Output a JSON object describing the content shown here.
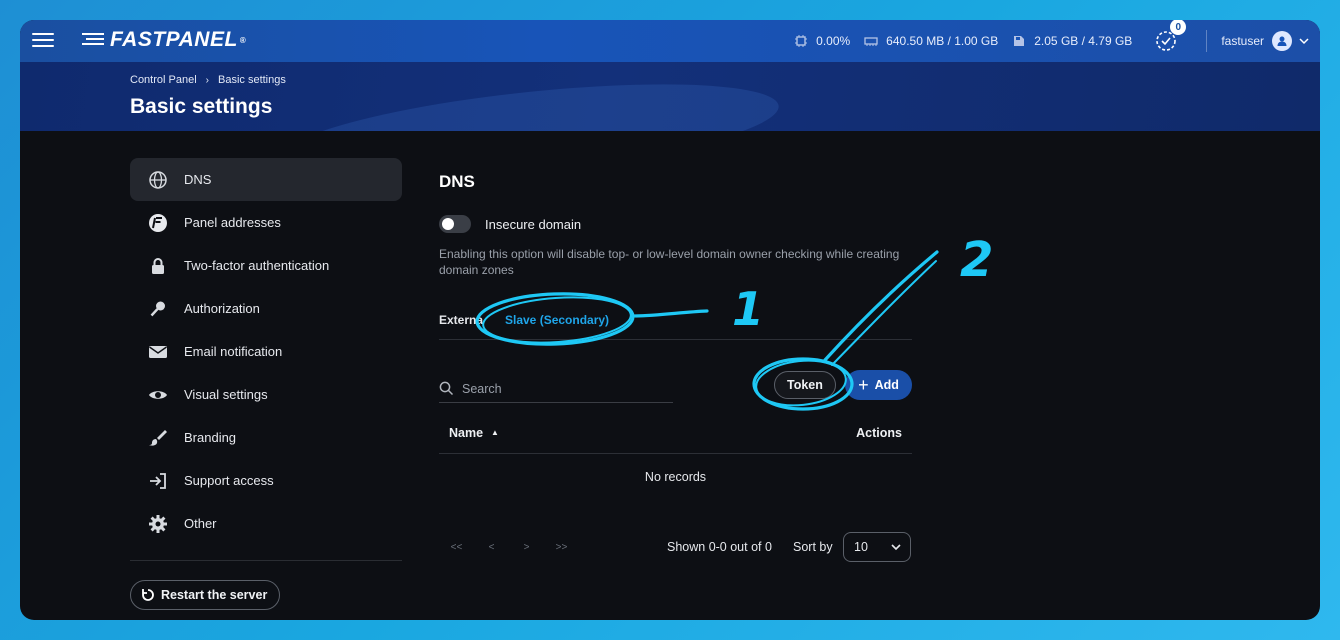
{
  "app": {
    "logo_text": "FASTPANEL",
    "trademark": "®"
  },
  "topbar": {
    "cpu": "0.00%",
    "ram": "640.50 MB / 1.00 GB",
    "disk": "2.05 GB / 4.79 GB",
    "tasks_count": "0",
    "username": "fastuser"
  },
  "breadcrumb": {
    "items": [
      "Control Panel",
      "Basic settings"
    ]
  },
  "page_title": "Basic settings",
  "sidebar": {
    "items": [
      {
        "label": "DNS",
        "icon": "globe-icon"
      },
      {
        "label": "Panel addresses",
        "icon": "fastpanel-f-icon"
      },
      {
        "label": "Two-factor authentication",
        "icon": "lock-icon"
      },
      {
        "label": "Authorization",
        "icon": "key-icon"
      },
      {
        "label": "Email notification",
        "icon": "envelope-icon"
      },
      {
        "label": "Visual settings",
        "icon": "eye-icon"
      },
      {
        "label": "Branding",
        "icon": "brush-icon"
      },
      {
        "label": "Support access",
        "icon": "sign-in-icon"
      },
      {
        "label": "Other",
        "icon": "gear-icon"
      }
    ],
    "restart_label": "Restart the server"
  },
  "main": {
    "title": "DNS",
    "insecure_label": "Insecure domain",
    "hint": "Enabling this option will disable top- or low-level domain owner checking while creating domain zones",
    "tabs": [
      {
        "label": "External"
      },
      {
        "label": "Slave (Secondary)"
      }
    ],
    "search_placeholder": "Search",
    "token_label": "Token",
    "add_label": "Add",
    "table": {
      "col_name": "Name",
      "col_actions": "Actions",
      "empty": "No records"
    },
    "pager": {
      "first": "<<",
      "prev": "<",
      "next": ">",
      "last": ">>",
      "shown": "Shown 0-0 out of 0",
      "sort_by": "Sort by",
      "page_size": "10"
    }
  },
  "annotations": {
    "label_1": "1",
    "label_2": "2",
    "color": "#1ec8f5"
  },
  "colors": {
    "accent": "#1fa5e9",
    "topbar": "#1854b8",
    "add_button": "#1a4fa8",
    "background": "#0d0f14"
  }
}
